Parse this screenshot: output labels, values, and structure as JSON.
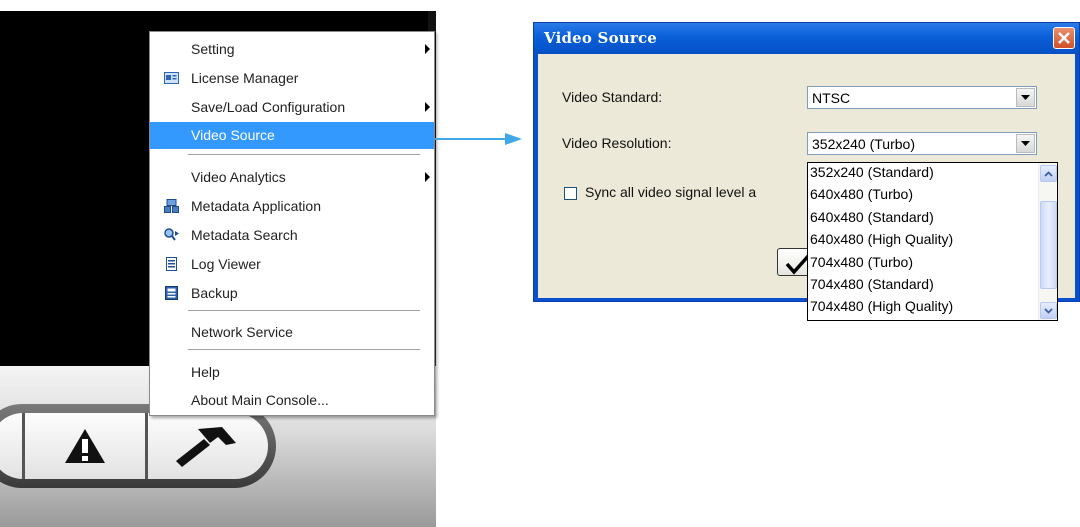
{
  "context_menu": {
    "items": [
      {
        "label": "Setting",
        "icon": "",
        "submenu": true
      },
      {
        "label": "License Manager",
        "icon": "license-icon",
        "submenu": false
      },
      {
        "label": "Save/Load Configuration",
        "icon": "",
        "submenu": true
      },
      {
        "label": "Video Source",
        "icon": "",
        "submenu": false,
        "highlighted": true
      },
      {
        "label": "Video Analytics",
        "icon": "",
        "submenu": true
      },
      {
        "label": "Metadata Application",
        "icon": "metadata-application-icon",
        "submenu": false
      },
      {
        "label": "Metadata Search",
        "icon": "metadata-search-icon",
        "submenu": false
      },
      {
        "label": "Log Viewer",
        "icon": "log-viewer-icon",
        "submenu": false
      },
      {
        "label": "Backup",
        "icon": "backup-icon",
        "submenu": false
      },
      {
        "label": "Network Service",
        "icon": "",
        "submenu": false
      },
      {
        "label": "Help",
        "icon": "",
        "submenu": false
      },
      {
        "label": "About Main Console...",
        "icon": "",
        "submenu": false
      }
    ],
    "highlight_color": "#3399ff"
  },
  "toolbar": {
    "buttons": [
      "alert-icon",
      "hammer-icon"
    ]
  },
  "dialog": {
    "title": "Video Source",
    "video_standard_label": "Video Standard:",
    "video_standard_value": "NTSC",
    "video_resolution_label": "Video Resolution:",
    "video_resolution_value": "352x240 (Turbo)",
    "sync_label": "Sync all video signal level a",
    "sync_checked": false,
    "titlebar_color": "#0a5fd8",
    "client_color": "#ece9d8"
  },
  "resolution_options": [
    "352x240 (Standard)",
    "640x480 (Turbo)",
    "640x480 (Standard)",
    "640x480 (High Quality)",
    "704x480 (Turbo)",
    "704x480 (Standard)",
    "704x480 (High Quality)"
  ],
  "arrow_color": "#3fa9e8"
}
